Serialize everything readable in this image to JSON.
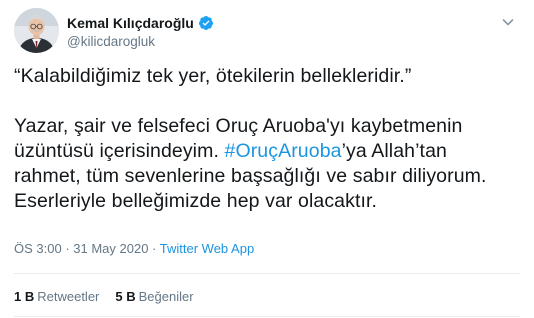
{
  "author": {
    "display_name": "Kemal Kılıçdaroğlu",
    "handle": "@kilicdarogluk",
    "verified": true
  },
  "tweet": {
    "quote": "“Kalabildiğimiz tek yer, ötekilerin bellekleridir.”",
    "line1": "Yazar, şair ve felsefeci Oruç Aruoba'yı kaybetmenin",
    "line2_pre": "üzüntüsü içerisindeyim. ",
    "hashtag": "#OruçAruoba",
    "line2_post": "’ya Allah’tan",
    "line3": "rahmet, tüm sevenlerine başsağlığı ve sabır diliyorum.",
    "line4": "Eserleriyle belleğimizde hep var olacaktır."
  },
  "meta": {
    "time": "ÖS 3:00",
    "separator": " · ",
    "date": "31 May 2020",
    "separator2": " · ",
    "app": "Twitter Web App"
  },
  "stats": {
    "retweets_count": "1 B",
    "retweets_label": "Retweetler",
    "likes_count": "5 B",
    "likes_label": "Beğeniler"
  },
  "colors": {
    "accent": "#1b95e0",
    "text": "#14171a",
    "muted": "#657786",
    "divider": "#e6ecf0"
  },
  "icons": {
    "verified": "verified-badge-icon",
    "menu": "chevron-down-icon"
  }
}
